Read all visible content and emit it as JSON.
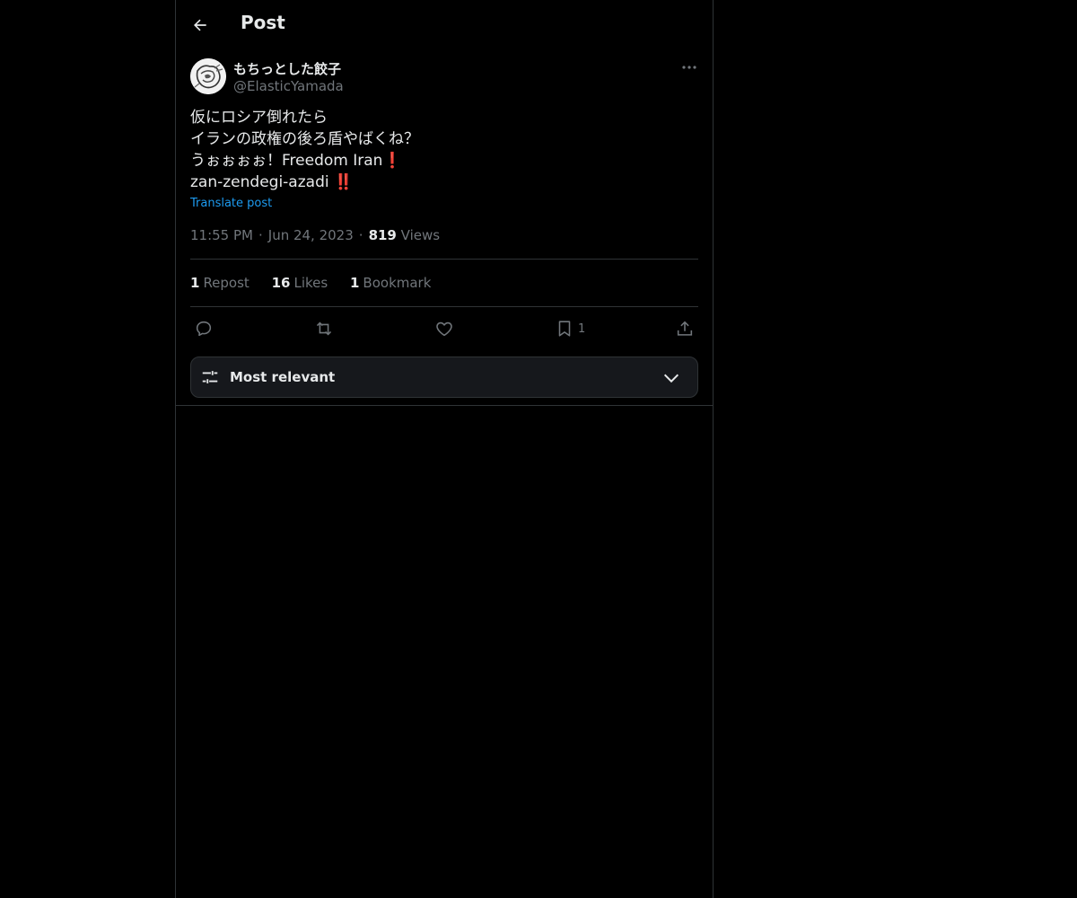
{
  "header": {
    "title": "Post"
  },
  "author": {
    "display_name": "もちっとした餃子",
    "handle": "@ElasticYamada"
  },
  "post": {
    "lines": [
      "仮にロシア倒れたら",
      "イランの政権の後ろ盾やばくね？",
      "うぉぉぉぉ！Freedom Iran",
      "zan-zendegi-azadi"
    ],
    "line3_emoji": "❗",
    "line4_emoji": "‼️",
    "translate_label": "Translate post"
  },
  "meta": {
    "time": "11:55 PM",
    "date": "Jun 24, 2023",
    "views_count": "819",
    "views_label": "Views",
    "separator": "·"
  },
  "stats": {
    "reposts_count": "1",
    "reposts_label": "Repost",
    "likes_count": "16",
    "likes_label": "Likes",
    "bookmarks_count": "1",
    "bookmarks_label": "Bookmark"
  },
  "actions": {
    "bookmark_count": "1"
  },
  "sort": {
    "label": "Most relevant"
  },
  "icons": {
    "back": "arrow-left-icon",
    "more": "more-horizontal-icon",
    "reply": "reply-icon",
    "repost": "repost-icon",
    "like": "heart-icon",
    "bookmark": "bookmark-icon",
    "share": "share-icon",
    "sort": "sliders-icon",
    "chevron": "chevron-down-icon"
  },
  "colors": {
    "background": "#000000",
    "text": "#e7e9ea",
    "muted": "#71767b",
    "accent": "#1d9bf0",
    "border": "#2f3336",
    "emoji_red": "#e0245e"
  }
}
